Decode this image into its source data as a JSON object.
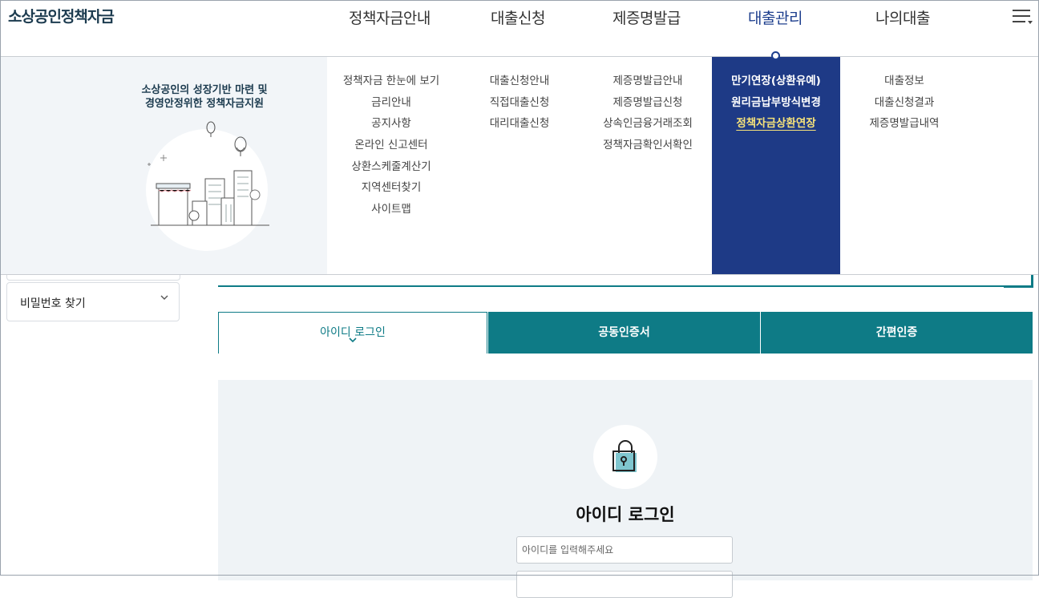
{
  "header": {
    "logo": "소상공인정책자금",
    "nav": [
      "정책자금안내",
      "대출신청",
      "제증명발급",
      "대출관리",
      "나의대출"
    ],
    "active_nav": "대출관리",
    "menu_icon": "hamburger-icon"
  },
  "mega_menu": {
    "slogan_line1": "소상공인의 성장기반 마련 및",
    "slogan_line2": "경영안정위한 정책자금지원",
    "columns": [
      {
        "items": [
          "정책자금 한눈에 보기",
          "금리안내",
          "공지사항",
          "온라인 신고센터",
          "상환스케줄계산기",
          "지역센터찾기",
          "사이트맵"
        ]
      },
      {
        "items": [
          "대출신청안내",
          "직접대출신청",
          "대리대출신청"
        ]
      },
      {
        "items": [
          "제증명발급안내",
          "제증명발급신청",
          "상속인금융거래조회",
          "정책자금확인서확인"
        ]
      },
      {
        "items": [
          "만기연장(상환유예)",
          "원리금납부방식변경",
          "정책자금상환연장"
        ],
        "selected": "정책자금상환연장"
      },
      {
        "items": [
          "대출정보",
          "대출신청결과",
          "제증명발급내역"
        ]
      }
    ]
  },
  "sidebar": {
    "find_password": "비밀번호 찾기"
  },
  "tabs": [
    "아이디 로그인",
    "공동인증서",
    "간편인증"
  ],
  "active_tab": "아이디 로그인",
  "login": {
    "title": "아이디 로그인",
    "id_placeholder": "아이디를 입력해주세요"
  },
  "colors": {
    "brand_navy": "#1e3a86",
    "teal": "#0e7b86",
    "highlight": "#f6e27a"
  }
}
